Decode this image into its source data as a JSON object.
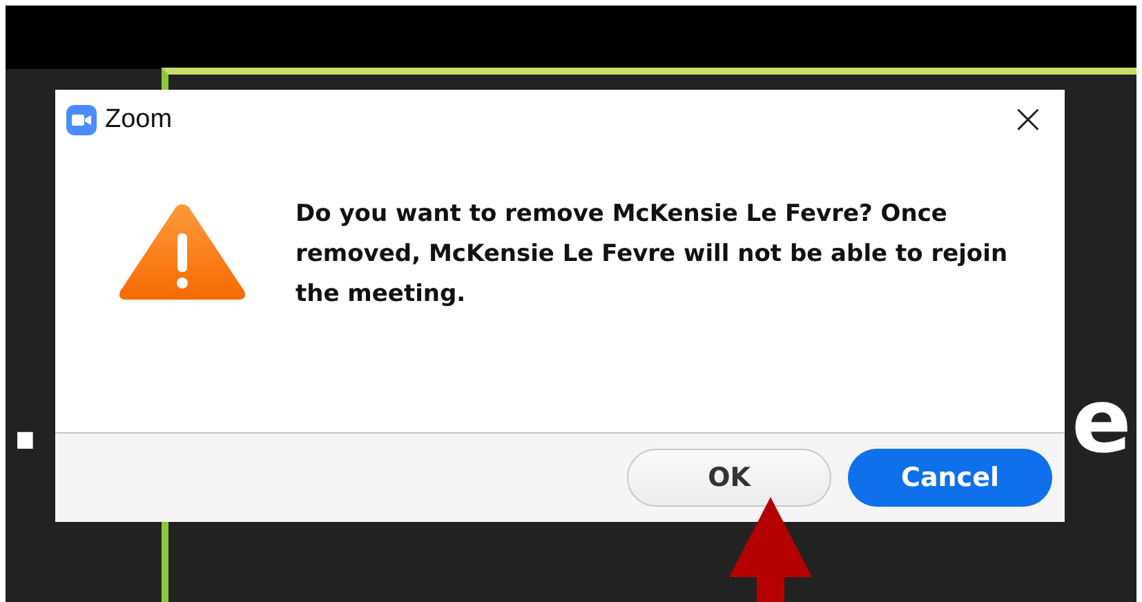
{
  "background": {
    "text_left": ".",
    "text_right": "e"
  },
  "dialog": {
    "title": "Zoom",
    "close": "×",
    "message": "Do you want to remove McKensie Le Fevre? Once removed, McKensie Le Fevre will not be able to rejoin the meeting.",
    "buttons": [
      {
        "label": "OK",
        "kind": "secondary"
      },
      {
        "label": "Cancel",
        "kind": "primary"
      }
    ]
  }
}
